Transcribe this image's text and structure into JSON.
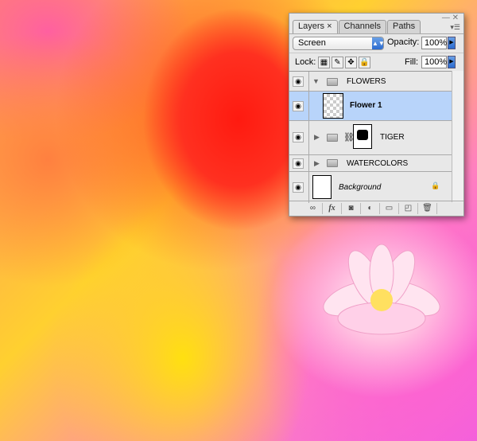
{
  "panel": {
    "tabs": [
      {
        "label": "Layers",
        "close": "×"
      },
      {
        "label": "Channels"
      },
      {
        "label": "Paths"
      }
    ],
    "blend_mode": "Screen",
    "opacity_label": "Opacity:",
    "opacity": "100%",
    "lock_label": "Lock:",
    "fill_label": "Fill:",
    "fill": "100%",
    "layers": [
      {
        "name": "FLOWERS",
        "type": "group",
        "expanded": true,
        "visible": true
      },
      {
        "name": "Flower 1",
        "type": "smart-object",
        "selected": true,
        "visible": true
      },
      {
        "name": "TIGER",
        "type": "group",
        "expanded": false,
        "masked": true,
        "visible": true
      },
      {
        "name": "WATERCOLORS",
        "type": "group",
        "expanded": false,
        "visible": true
      },
      {
        "name": "Background",
        "type": "background",
        "locked": true,
        "visible": true
      }
    ],
    "bottom_buttons": [
      "link-layers",
      "fx",
      "add-mask",
      "adjustment-layer",
      "new-group",
      "new-layer",
      "delete-layer"
    ],
    "bottom_fx_label": "fx"
  },
  "colors": {
    "selection": "#b8d4fa",
    "accent": "#2b6bd0"
  }
}
